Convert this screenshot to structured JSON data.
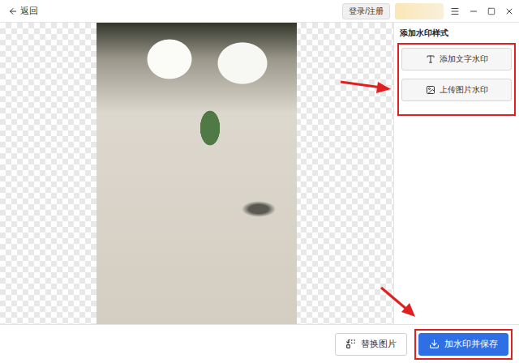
{
  "window": {
    "back": "返回",
    "login": "登录/注册"
  },
  "panel": {
    "title": "添加水印样式",
    "highlighted": true,
    "buttons": [
      {
        "label": "添加文字水印",
        "kind": "text"
      },
      {
        "label": "上传图片水印",
        "kind": "image"
      }
    ]
  },
  "footer": {
    "buttons": [
      {
        "label": "替换图片",
        "kind": "secondary",
        "highlighted": false
      },
      {
        "label": "加水印并保存",
        "kind": "primary",
        "highlighted": true
      }
    ]
  }
}
